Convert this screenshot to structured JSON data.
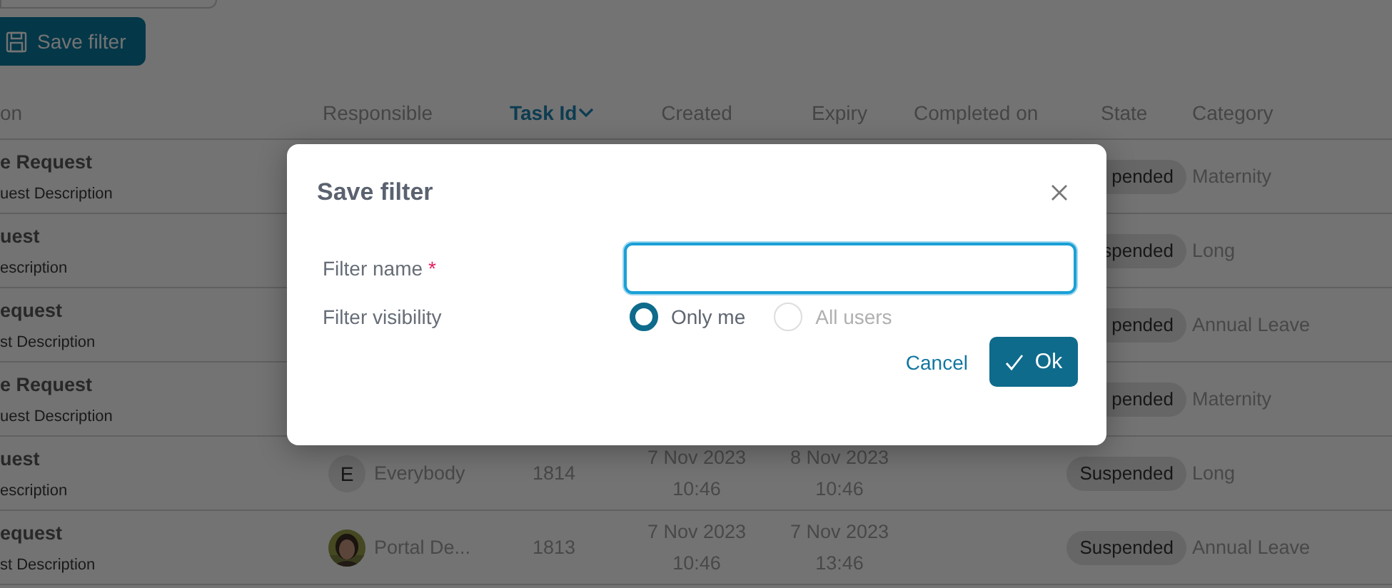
{
  "toolbar": {
    "save_filter_button": "Save filter"
  },
  "table": {
    "columns": [
      {
        "label": "on",
        "sorted": false
      },
      {
        "label": "Responsible",
        "sorted": false
      },
      {
        "label": "Task Id",
        "sorted": true
      },
      {
        "label": "Created",
        "sorted": false
      },
      {
        "label": "Expiry",
        "sorted": false
      },
      {
        "label": "Completed on",
        "sorted": false
      },
      {
        "label": "State",
        "sorted": false
      },
      {
        "label": "Category",
        "sorted": false
      }
    ],
    "rows": [
      {
        "title": "e Request",
        "description": "uest Description",
        "state": "pended",
        "state_cut": true,
        "category": "Maternity"
      },
      {
        "title": "uest",
        "description": "escription",
        "state": "spended",
        "state_cut": true,
        "category": "Long"
      },
      {
        "title": "equest",
        "description": "st Description",
        "state": "pended",
        "state_cut": true,
        "category": "Annual Leave"
      },
      {
        "title": "e Request",
        "description": "uest Description",
        "state": "pended",
        "state_cut": true,
        "category": "Maternity"
      },
      {
        "title": "uest",
        "description": "escription",
        "responsible": {
          "name": "Everybody",
          "avatar": {
            "kind": "initial",
            "initial": "E"
          }
        },
        "task_id": "1814",
        "created": "7 Nov 2023 10:46",
        "expiry": "8 Nov 2023 10:46",
        "state": "Suspended",
        "state_cut": false,
        "category": "Long"
      },
      {
        "title": "equest",
        "description": "st Description",
        "responsible": {
          "name": "Portal De..."
        },
        "task_id": "1813",
        "created": "7 Nov 2023 10:46",
        "expiry": "7 Nov 2023 13:46",
        "state": "Suspended",
        "state_cut": false,
        "category": "Annual Leave"
      }
    ]
  },
  "dialog": {
    "title": "Save filter",
    "name_field": {
      "label": "Filter name",
      "required_mark": "*",
      "focused": true
    },
    "visibility": {
      "label": "Filter visibility",
      "options": [
        {
          "label": "Only me",
          "selected": true,
          "disabled": false
        },
        {
          "label": "All users",
          "selected": false,
          "disabled": true
        }
      ]
    },
    "cancel_button": "Cancel",
    "ok_button": "Ok"
  }
}
